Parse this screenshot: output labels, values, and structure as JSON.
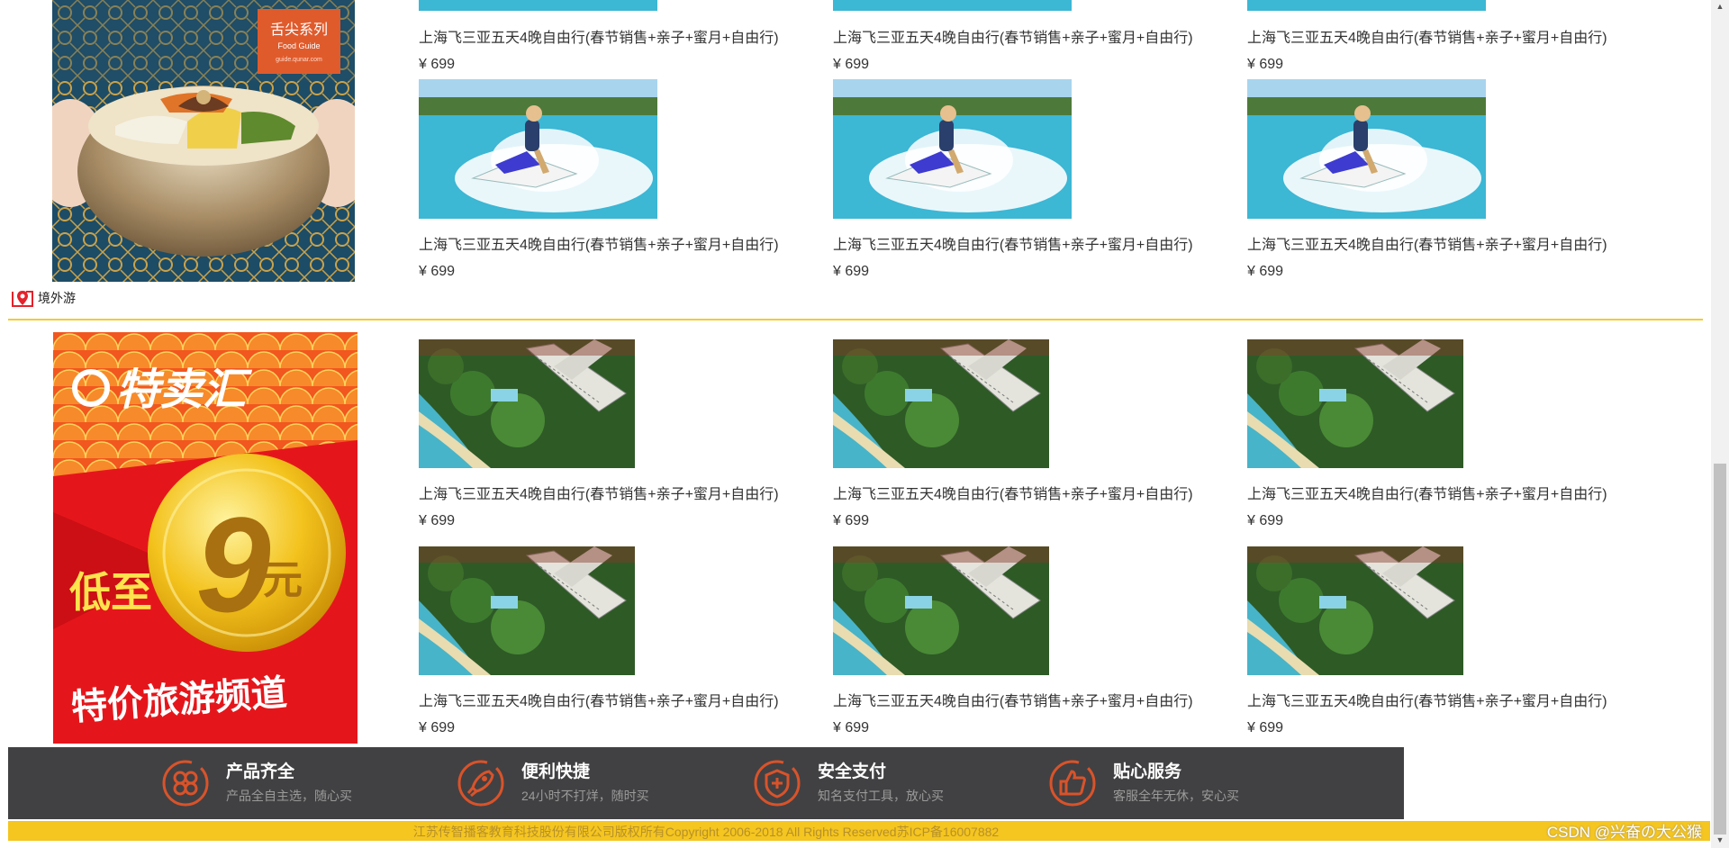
{
  "product_title": "上海飞三亚五天4晚自由行(春节销售+亲子+蜜月+自由行)",
  "product_price": "¥ 699",
  "top_promo": {
    "tag_line1": "舌尖系列",
    "tag_line2": "Food Guide",
    "tag_line3": "guide.qunar.com"
  },
  "section": {
    "label": "境外游"
  },
  "sale_promo": {
    "brand": "特卖汇",
    "low": "低至",
    "amount": "9",
    "unit": "元",
    "channel": "特价旅游频道"
  },
  "features": [
    {
      "name": "产品齐全",
      "desc": "产品全自主选，随心买",
      "icon": "clover-icon"
    },
    {
      "name": "便利快捷",
      "desc": "24小时不打烊，随时买",
      "icon": "rocket-icon"
    },
    {
      "name": "安全支付",
      "desc": "知名支付工具，放心买",
      "icon": "shield-icon"
    },
    {
      "name": "贴心服务",
      "desc": "客服全年无休，安心买",
      "icon": "thumbs-up-icon"
    }
  ],
  "copyright": "江苏传智播客教育科技股份有限公司版权所有Copyright 2006-2018 All Rights Reserved苏ICP备16007882",
  "watermark": "CSDN @兴奋の大公猴",
  "colors": {
    "price": "#e5212b",
    "divider": "#f2cc2f",
    "feature_bar": "#414143",
    "copyright_bar": "#f5c520",
    "icon_accent": "#d9532a"
  }
}
